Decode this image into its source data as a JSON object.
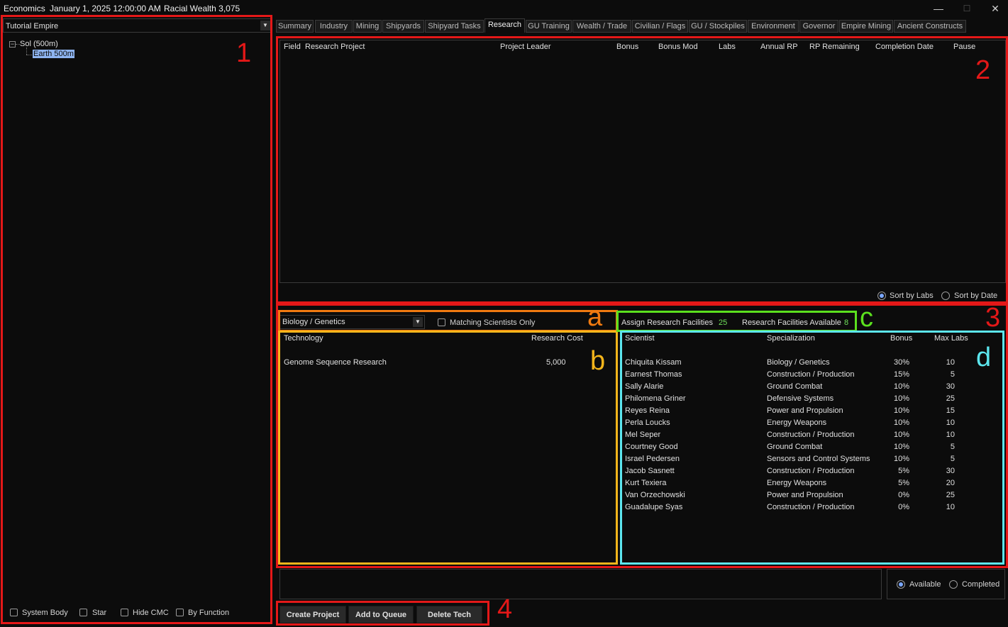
{
  "titlebar": {
    "app": "Economics",
    "date": "January 1, 2025 12:00:00 AM",
    "wealth": "Racial Wealth 3,075"
  },
  "left": {
    "empire": "Tutorial Empire",
    "tree": [
      {
        "label": "Sol  (500m)"
      },
      {
        "label": "Earth  500m"
      }
    ],
    "footer": [
      "System Body",
      "Star",
      "Hide CMC",
      "By Function"
    ]
  },
  "tabs": [
    "Summary",
    "Industry",
    "Mining",
    "Shipyards",
    "Shipyard Tasks",
    "Research",
    "GU Training",
    "Wealth / Trade",
    "Civilian / Flags",
    "GU / Stockpiles",
    "Environment",
    "Governor",
    "Empire Mining",
    "Ancient Constructs"
  ],
  "research_grid": {
    "columns": [
      "Field",
      "Research Project",
      "Project Leader",
      "Bonus",
      "Bonus Mod",
      "Labs",
      "Annual RP",
      "RP Remaining",
      "Completion Date",
      "Pause"
    ]
  },
  "sort": {
    "labs": "Sort by Labs",
    "date": "Sort by Date"
  },
  "field_select": "Biology / Genetics",
  "matching_only": "Matching Scientists Only",
  "facilities": {
    "assign_label": "Assign Research Facilities",
    "assign_value": "25",
    "available_label": "Research Facilities Available",
    "available_value": "8"
  },
  "tech_table": {
    "headers": {
      "tech": "Technology",
      "cost": "Research Cost"
    },
    "rows": [
      {
        "tech": "Genome Sequence Research",
        "cost": "5,000"
      }
    ]
  },
  "scientist_table": {
    "headers": {
      "name": "Scientist",
      "spec": "Specialization",
      "bonus": "Bonus",
      "labs": "Max Labs"
    },
    "rows": [
      {
        "name": "Chiquita Kissam",
        "spec": "Biology / Genetics",
        "bonus": "30%",
        "labs": "10"
      },
      {
        "name": "Earnest Thomas",
        "spec": "Construction / Production",
        "bonus": "15%",
        "labs": "5"
      },
      {
        "name": "Sally Alarie",
        "spec": "Ground Combat",
        "bonus": "10%",
        "labs": "30"
      },
      {
        "name": "Philomena Griner",
        "spec": "Defensive Systems",
        "bonus": "10%",
        "labs": "25"
      },
      {
        "name": "Reyes Reina",
        "spec": "Power and Propulsion",
        "bonus": "10%",
        "labs": "15"
      },
      {
        "name": "Perla Loucks",
        "spec": "Energy Weapons",
        "bonus": "10%",
        "labs": "10"
      },
      {
        "name": "Mel Seper",
        "spec": "Construction / Production",
        "bonus": "10%",
        "labs": "10"
      },
      {
        "name": "Courtney Good",
        "spec": "Ground Combat",
        "bonus": "10%",
        "labs": "5"
      },
      {
        "name": "Israel Pedersen",
        "spec": "Sensors and Control Systems",
        "bonus": "10%",
        "labs": "5"
      },
      {
        "name": "Jacob Sasnett",
        "spec": "Construction / Production",
        "bonus": "5%",
        "labs": "30"
      },
      {
        "name": "Kurt Texiera",
        "spec": "Energy Weapons",
        "bonus": "5%",
        "labs": "20"
      },
      {
        "name": "Van Orzechowski",
        "spec": "Power and Propulsion",
        "bonus": "0%",
        "labs": "25"
      },
      {
        "name": "Guadalupe Syas",
        "spec": "Construction / Production",
        "bonus": "0%",
        "labs": "10"
      }
    ]
  },
  "filter": {
    "available": "Available",
    "completed": "Completed"
  },
  "buttons": {
    "create": "Create Project",
    "queue": "Add to Queue",
    "delete": "Delete Tech"
  },
  "annotations": {
    "n1": "1",
    "n2": "2",
    "n3": "3",
    "n4": "4",
    "a": "a",
    "b": "b",
    "c": "c",
    "d": "d"
  },
  "colors": {
    "red": "#e41818",
    "orange": "#f07a10",
    "yellow": "#f5b51b",
    "green": "#5be01e",
    "cyan": "#5ce6ee",
    "highlight": "#8eb4f0"
  }
}
